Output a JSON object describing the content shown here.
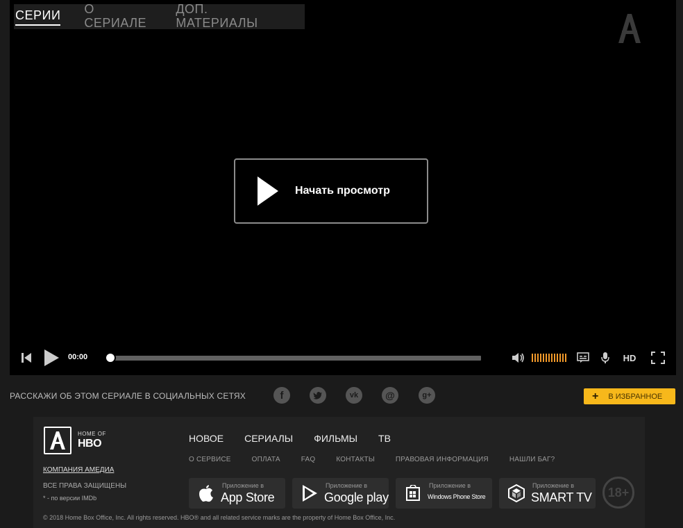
{
  "tabs": [
    {
      "label": "СЕРИИ",
      "active": true
    },
    {
      "label": "О СЕРИАЛЕ",
      "active": false
    },
    {
      "label": "ДОП. МАТЕРИАЛЫ",
      "active": false
    }
  ],
  "player": {
    "start_label": "Начать просмотр",
    "time": "00:00",
    "progress": 0,
    "quality_label": "HD",
    "volume_level": 1.0
  },
  "share": {
    "text": "РАССКАЖИ ОБ ЭТОМ СЕРИАЛЕ В СОЦИАЛЬНЫХ СЕТЯХ",
    "networks": [
      "facebook-icon",
      "twitter-icon",
      "vk-icon",
      "mail-icon",
      "google-plus-icon"
    ],
    "favorite_label": "В ИЗБРАННОЕ"
  },
  "footer": {
    "home_of": "HOME OF",
    "hbo": "HBO",
    "company_link": "КОМПАНИЯ АМЕДИА",
    "rights": "ВСЕ ПРАВА ЗАЩИЩЕНЫ",
    "imdb_note": "* - по версии IMDb",
    "main_nav": [
      "НОВОЕ",
      "СЕРИАЛЫ",
      "ФИЛЬМЫ",
      "ТВ"
    ],
    "sub_nav": [
      "О СЕРВИСЕ",
      "ОПЛАТА",
      "FAQ",
      "КОНТАКТЫ",
      "ПРАВОВАЯ ИНФОРМАЦИЯ",
      "НАШЛИ БАГ?"
    ],
    "stores": [
      {
        "small": "Приложение в",
        "big": "App Store",
        "icon": "apple-icon"
      },
      {
        "small": "Приложение в",
        "big": "Google play",
        "icon": "google-play-icon"
      },
      {
        "small": "Приложение в",
        "big": "Windows Phone Store",
        "icon": "windows-icon"
      },
      {
        "small": "Приложение в",
        "big": "SMART TV",
        "icon": "smart-tv-icon"
      }
    ],
    "age_rating": "18+",
    "copyright": "© 2018 Home Box Office, Inc. All rights reserved. HBO® and all related service marks are the property of Home Box Office, Inc."
  },
  "colors": {
    "accent": "#f7b81b",
    "volume": "#f39a2a",
    "background": "#1b1b1b",
    "player": "#000000"
  }
}
